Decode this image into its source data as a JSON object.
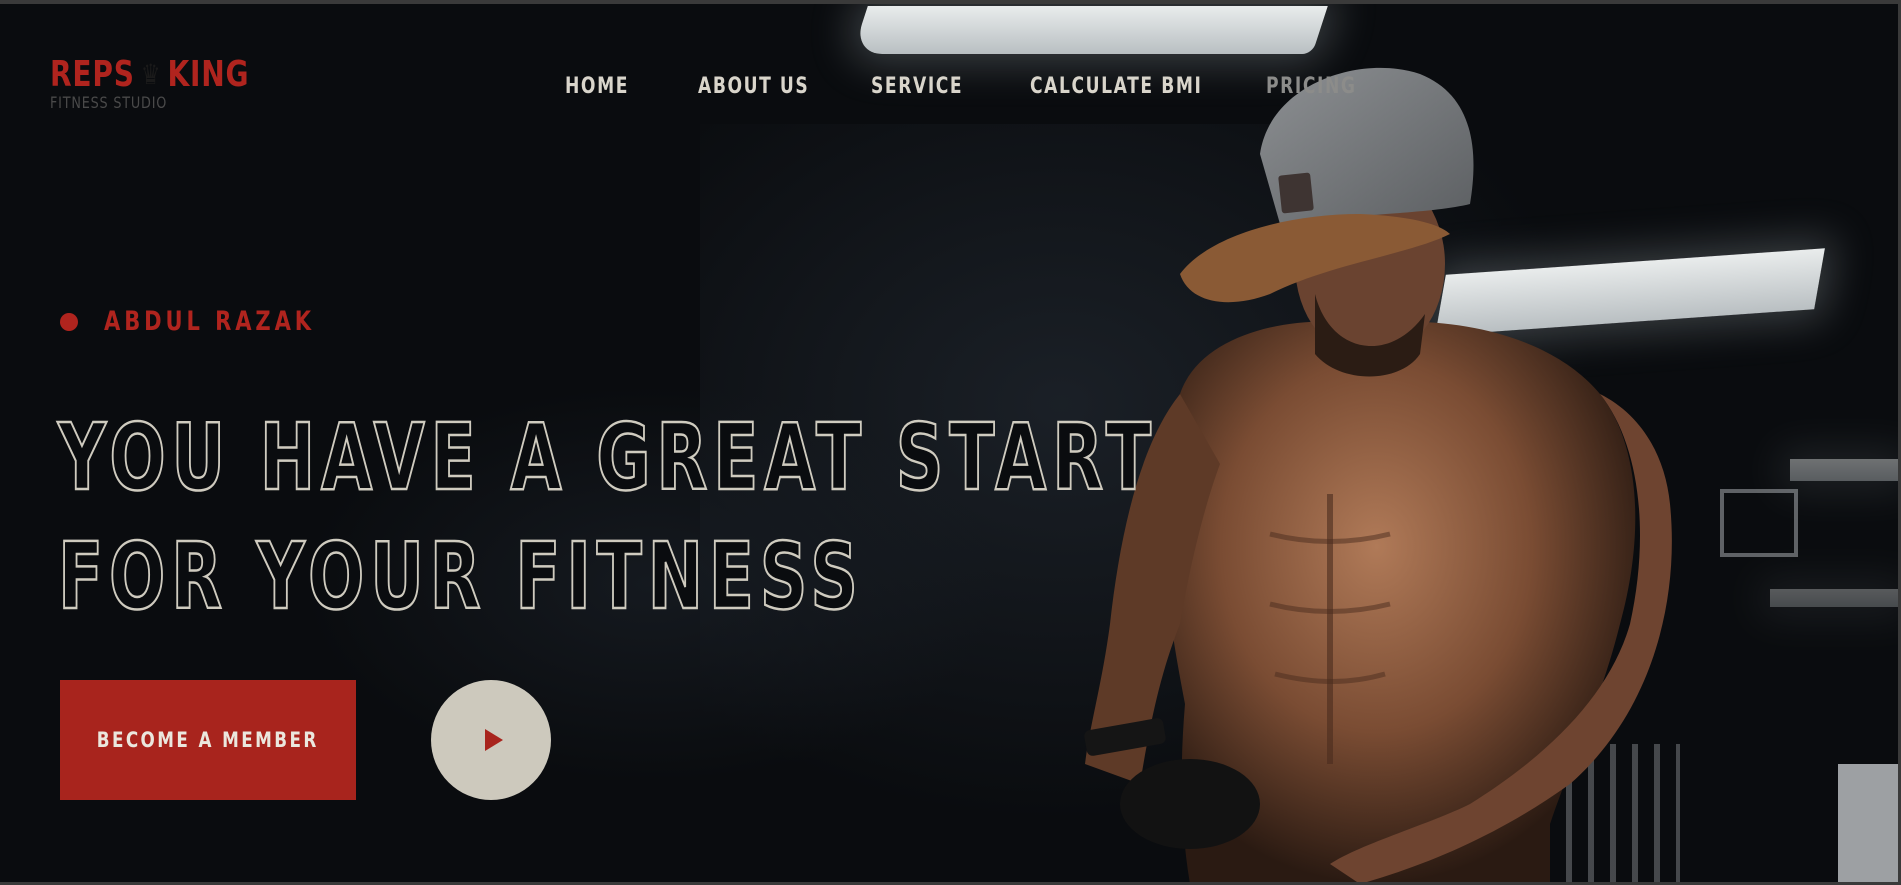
{
  "brand": {
    "name_left": "REPS",
    "name_right": "KING",
    "tagline": "FITNESS STUDIO",
    "logo_icon": "crown-kettlebell-icon",
    "accent_color": "#b0241e"
  },
  "nav": {
    "items": [
      {
        "label": "HOME"
      },
      {
        "label": "ABOUT US"
      },
      {
        "label": "SERVICE"
      },
      {
        "label": "CALCULATE BMI"
      },
      {
        "label": "PRICING"
      }
    ]
  },
  "hero": {
    "kicker": "ABDUL RAZAK",
    "headline_line1": "YOU HAVE A GREAT START",
    "headline_line2": "FOR YOUR FITNESS",
    "cta_label": "BECOME A MEMBER",
    "play_icon": "play-icon",
    "cta_color": "#a8241d",
    "play_bg_color": "#cdc9bd"
  }
}
